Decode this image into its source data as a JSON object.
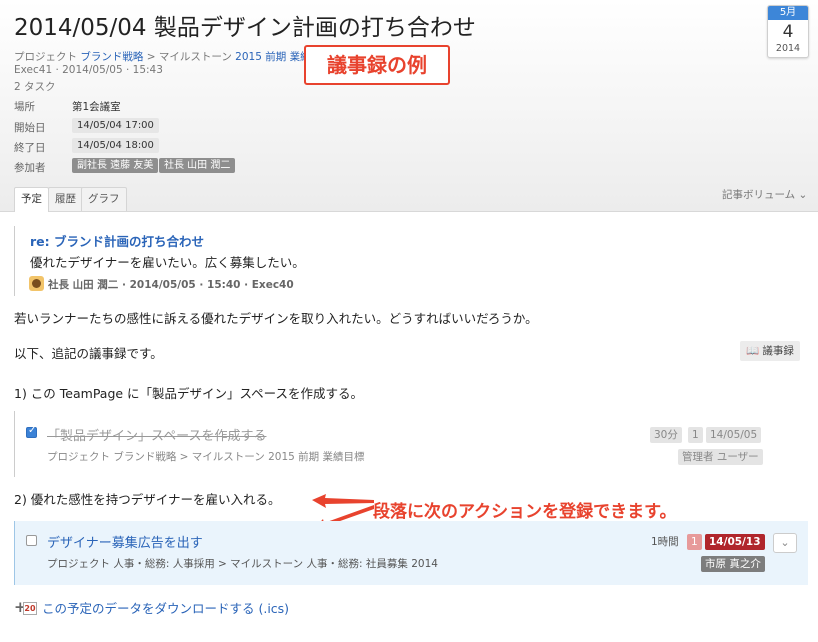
{
  "page": {
    "title": "2014/05/04 製品デザイン計画の打ち合わせ",
    "breadcrumb": {
      "prefix": "プロジェクト",
      "project": "ブランド戦略",
      "sep": ">",
      "milestone_label": "マイルストーン",
      "milestone": "2015 前期 業績目標"
    },
    "entry_info": "Exec41 · 2014/05/05 · 15:43",
    "task_count": "2 タスク",
    "callout": "議事録の例"
  },
  "calendar": {
    "month": "5月",
    "day": "4",
    "year": "2014"
  },
  "properties": {
    "place_label": "場所",
    "place_value": "第1会議室",
    "start_label": "開始日",
    "start_value": "14/05/04 17:00",
    "end_label": "終了日",
    "end_value": "14/05/04 18:00",
    "attendees_label": "参加者",
    "attendees": [
      "副社長 遠藤 友美",
      "社長 山田 潤二"
    ]
  },
  "tabs": [
    "予定",
    "履歴",
    "グラフ"
  ],
  "article_volume": "記事ボリューム ⌄",
  "quote": {
    "title": "re: ブランド計画の打ち合わせ",
    "body": "優れたデザイナーを雇いたい。広く募集したい。",
    "author": "社長 山田 潤二 · 2014/05/05 · 15:40 · Exec40"
  },
  "body": {
    "p1": "若いランナーたちの感性に訴える優れたデザインを取り入れたい。どうすればいいだろうか。",
    "p2": "以下、追記の議事録です。",
    "minutes_button": "議事録",
    "item1": "1) この TeamPage に「製品デザイン」スペースを作成する。",
    "item2": "2) 優れた感性を持つデザイナーを雇い入れる。"
  },
  "tasks": [
    {
      "title": "「製品デザイン」スペースを作成する",
      "path": "プロジェクト ブランド戦略 > マイルストーン 2015 前期 業績目標",
      "done": true,
      "duration": "30分",
      "priority": "1",
      "due": "14/05/05",
      "assignee": "管理者 ユーザー"
    },
    {
      "title": "デザイナー募集広告を出す",
      "path": "プロジェクト 人事・総務: 人事採用 > マイルストーン 人事・総務: 社員募集 2014",
      "done": false,
      "duration": "1時間",
      "priority": "1",
      "due": "14/05/13",
      "assignee": "市原 真之介"
    }
  ],
  "annotation": "段落に次のアクションを登録できます。",
  "download_link": "この予定のデータをダウンロードする (.ics)",
  "download_icon_text": "20",
  "colors": {
    "link": "#2a64b8",
    "callout": "#e8432e",
    "overdue": "#b0262c",
    "calendar_header": "#3d86d8"
  }
}
